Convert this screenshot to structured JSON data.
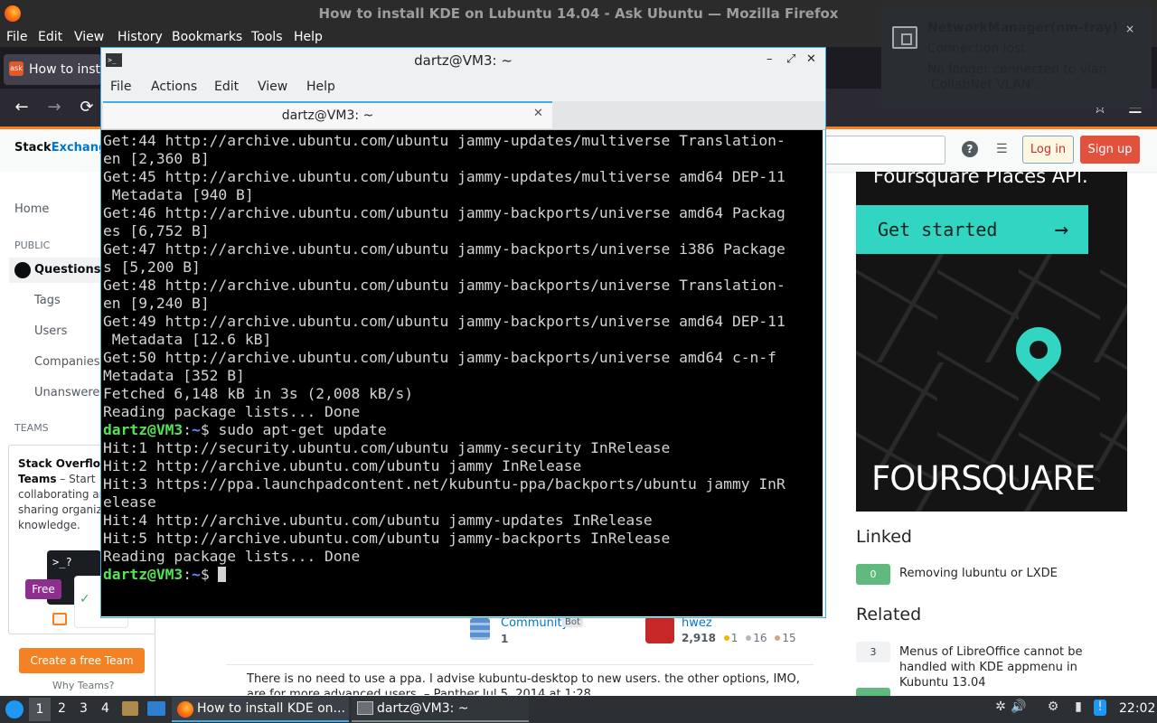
{
  "firefox": {
    "window_title": "How to install KDE on Lubuntu 14.04 - Ask Ubuntu — Mozilla Firefox",
    "menu": [
      "File",
      "Edit",
      "View",
      "History",
      "Bookmarks",
      "Tools",
      "Help"
    ],
    "tab_label": "How to insta",
    "tab_icon_text": "ask",
    "nav": {
      "back": "←",
      "forward": "→",
      "reload": "⟳",
      "bookmark_star": "☆",
      "menu": "☰"
    }
  },
  "stack": {
    "logo_prefix": "Stack",
    "logo_suffix": "Exchange",
    "help_glyph": "?",
    "login": "Log in",
    "signup": "Sign up",
    "sidebar": {
      "home": "Home",
      "public": "PUBLIC",
      "questions": "Questions",
      "tags": "Tags",
      "users": "Users",
      "companies": "Companies",
      "unanswered": "Unanswered",
      "teams": "TEAMS"
    },
    "teams_box": {
      "title": "Stack Overflow Teams",
      "desc": " – Start collaborating and sharing organizational knowledge.",
      "illus": ">_?",
      "free": "Free",
      "create": "Create a free Team",
      "why": "Why Teams?"
    },
    "post": {
      "community_name": "Community",
      "community_bot": "Bot",
      "community_rep": "1",
      "hwez_name": "hwez",
      "hwez_rep": "2,918",
      "hwez_gold": "1",
      "hwez_silver": "16",
      "hwez_bronze": "15",
      "answer_text": "There is no need to use a ppa. I advise kubuntu-desktop to new users. the other options, IMO, are for more advanced users. – Panther Jul 5, 2014 at 1:28"
    },
    "ad": {
      "headline": "Foursquare Places API.",
      "button": "Get started",
      "button_arrow": "→",
      "brand": "FOURSQUARE"
    },
    "linked": {
      "heading": "Linked",
      "items": [
        {
          "votes": "0",
          "title": "Removing lubuntu or LXDE"
        }
      ]
    },
    "related": {
      "heading": "Related",
      "items": [
        {
          "votes": "3",
          "title": "Menus of LibreOffice cannot be handled with KDE appmenu in Kubuntu 13.04"
        }
      ]
    }
  },
  "terminal": {
    "window_title": "dartz@VM3: ~",
    "icon_text": ">_",
    "controls": {
      "minimize": "–",
      "maximize": "⤢",
      "close": "✕"
    },
    "menu": [
      "File",
      "Actions",
      "Edit",
      "View",
      "Help"
    ],
    "tab_label": "dartz@VM3: ~",
    "tab_close": "✕",
    "lines": [
      "Get:44 http://archive.ubuntu.com/ubuntu jammy-updates/multiverse Translation-",
      "en [2,360 B]",
      "Get:45 http://archive.ubuntu.com/ubuntu jammy-updates/multiverse amd64 DEP-11",
      " Metadata [940 B]",
      "Get:46 http://archive.ubuntu.com/ubuntu jammy-backports/universe amd64 Packag",
      "es [6,752 B]",
      "Get:47 http://archive.ubuntu.com/ubuntu jammy-backports/universe i386 Package",
      "s [5,200 B]",
      "Get:48 http://archive.ubuntu.com/ubuntu jammy-backports/universe Translation-",
      "en [9,240 B]",
      "Get:49 http://archive.ubuntu.com/ubuntu jammy-backports/universe amd64 DEP-11",
      " Metadata [12.6 kB]",
      "Get:50 http://archive.ubuntu.com/ubuntu jammy-backports/universe amd64 c-n-f",
      "Metadata [352 B]",
      "Fetched 6,148 kB in 3s (2,008 kB/s)",
      "Reading package lists... Done"
    ],
    "prompt_user": "dartz@VM3",
    "prompt_sep": ":",
    "prompt_path": "~",
    "prompt_end": "$ ",
    "command": "sudo apt-get update",
    "lines2": [
      "Hit:1 http://security.ubuntu.com/ubuntu jammy-security InRelease",
      "Hit:2 http://archive.ubuntu.com/ubuntu jammy InRelease",
      "Hit:3 https://ppa.launchpadcontent.net/kubuntu-ppa/backports/ubuntu jammy InR",
      "elease",
      "Hit:4 http://archive.ubuntu.com/ubuntu jammy-updates InRelease",
      "Hit:5 http://archive.ubuntu.com/ubuntu jammy-backports InRelease",
      "Reading package lists... Done"
    ]
  },
  "notification": {
    "title": "NetworkManager(nm-tray)",
    "subtitle": "Connection lost",
    "body": "No longer connected to vlan 'CollabNet VLAN'.",
    "close": "×"
  },
  "taskbar": {
    "desktops": [
      "1",
      "2",
      "3",
      "4"
    ],
    "firefox_task": "How to install KDE on...",
    "terminal_task": "dartz@VM3: ~",
    "clock": "22:02",
    "tray_glyphs": [
      "✲",
      "🔊",
      "⚙",
      "▮",
      "!"
    ]
  }
}
